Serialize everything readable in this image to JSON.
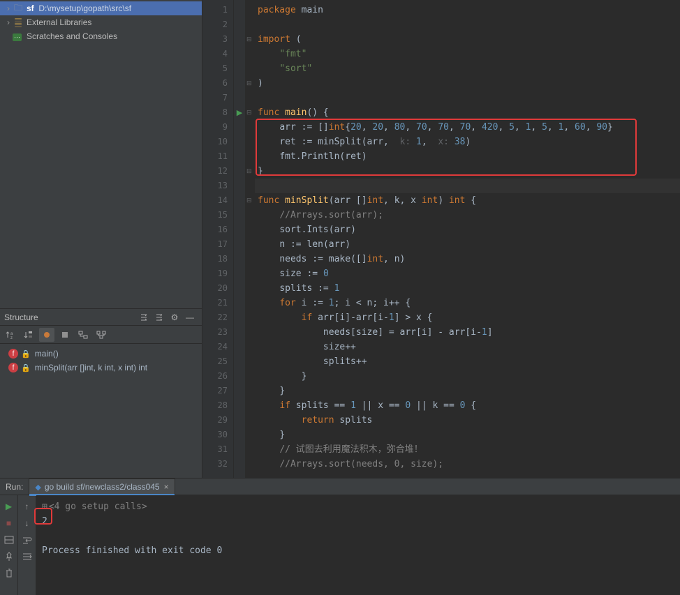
{
  "project": {
    "root_name": "sf",
    "root_path": "D:\\mysetup\\gopath\\src\\sf",
    "external_libraries": "External Libraries",
    "scratches": "Scratches and Consoles"
  },
  "structure": {
    "title": "Structure",
    "items": [
      {
        "name": "main()",
        "label": "main()"
      },
      {
        "name": "minSplit",
        "label": "minSplit(arr []int, k int, x int) int"
      }
    ]
  },
  "code": {
    "lines": [
      {
        "n": 1,
        "fold": "",
        "run": false
      },
      {
        "n": 2,
        "fold": "",
        "run": false
      },
      {
        "n": 3,
        "fold": "⊟",
        "run": false
      },
      {
        "n": 4,
        "fold": "",
        "run": false
      },
      {
        "n": 5,
        "fold": "",
        "run": false
      },
      {
        "n": 6,
        "fold": "⊟",
        "run": false
      },
      {
        "n": 7,
        "fold": "",
        "run": false
      },
      {
        "n": 8,
        "fold": "⊟",
        "run": true
      },
      {
        "n": 9,
        "fold": "",
        "run": false
      },
      {
        "n": 10,
        "fold": "",
        "run": false
      },
      {
        "n": 11,
        "fold": "",
        "run": false
      },
      {
        "n": 12,
        "fold": "⊟",
        "run": false
      },
      {
        "n": 13,
        "fold": "",
        "run": false
      },
      {
        "n": 14,
        "fold": "⊟",
        "run": false
      },
      {
        "n": 15,
        "fold": "",
        "run": false
      },
      {
        "n": 16,
        "fold": "",
        "run": false
      },
      {
        "n": 17,
        "fold": "",
        "run": false
      },
      {
        "n": 18,
        "fold": "",
        "run": false
      },
      {
        "n": 19,
        "fold": "",
        "run": false
      },
      {
        "n": 20,
        "fold": "",
        "run": false
      },
      {
        "n": 21,
        "fold": "",
        "run": false
      },
      {
        "n": 22,
        "fold": "",
        "run": false
      },
      {
        "n": 23,
        "fold": "",
        "run": false
      },
      {
        "n": 24,
        "fold": "",
        "run": false
      },
      {
        "n": 25,
        "fold": "",
        "run": false
      },
      {
        "n": 26,
        "fold": "",
        "run": false
      },
      {
        "n": 27,
        "fold": "",
        "run": false
      },
      {
        "n": 28,
        "fold": "",
        "run": false
      },
      {
        "n": 29,
        "fold": "",
        "run": false
      },
      {
        "n": 30,
        "fold": "",
        "run": false
      },
      {
        "n": 31,
        "fold": "",
        "run": false
      },
      {
        "n": 32,
        "fold": "",
        "run": false
      }
    ],
    "tokens": {
      "package": "package",
      "main": "main",
      "import": "import",
      "fmt": "\"fmt\"",
      "sort": "\"sort\"",
      "func": "func",
      "int_type": "int",
      "arr_decl": "arr := []",
      "arr_nums": [
        "20",
        "20",
        "80",
        "70",
        "70",
        "70",
        "420",
        "5",
        "1",
        "5",
        "1",
        "60",
        "90"
      ],
      "ret_decl": "ret := minSplit(arr, ",
      "k_hint": "k:",
      "k_val": "1",
      "x_hint": "x:",
      "x_val": "38",
      "println": "fmt.Println(ret)",
      "minsplit_sig_a": "minSplit(arr []",
      "minsplit_sig_b": ", k, x ",
      "minsplit_sig_r": ") ",
      "c_arrsort": "//Arrays.sort(arr);",
      "sort_ints": "sort.Ints(arr)",
      "n_len": "n := len(arr)",
      "needs": "needs := make([]",
      "needs2": ", n)",
      "size0": "size := ",
      "zero": "0",
      "splits1": "splits := ",
      "one": "1",
      "for": "for",
      "for_sig_a": " i := ",
      "for_sig_b": "; i < n; i++ {",
      "if": "if",
      "if_cond": " arr[i]-arr[i-",
      "ifx": "] > x {",
      "assign": "needs[size] = arr[i] - arr[i-",
      "assign2": "]",
      "sizepp": "size++",
      "splitspp": "splits++",
      "if_splits": " splits == ",
      "or": " || ",
      "x0": "x == ",
      "k0": "k == ",
      "return": "return",
      "ret_splits": " splits",
      "cmt_cn": "// 试图去利用魔法积木，弥合堆！",
      "cmt_sort2": "//Arrays.sort(needs, 0, size);"
    }
  },
  "run": {
    "label": "Run:",
    "tab_title": "go build sf/newclass2/class045",
    "folded_calls": "<4 go setup calls>",
    "output_value": "2",
    "exit_msg": "Process finished with exit code 0"
  }
}
